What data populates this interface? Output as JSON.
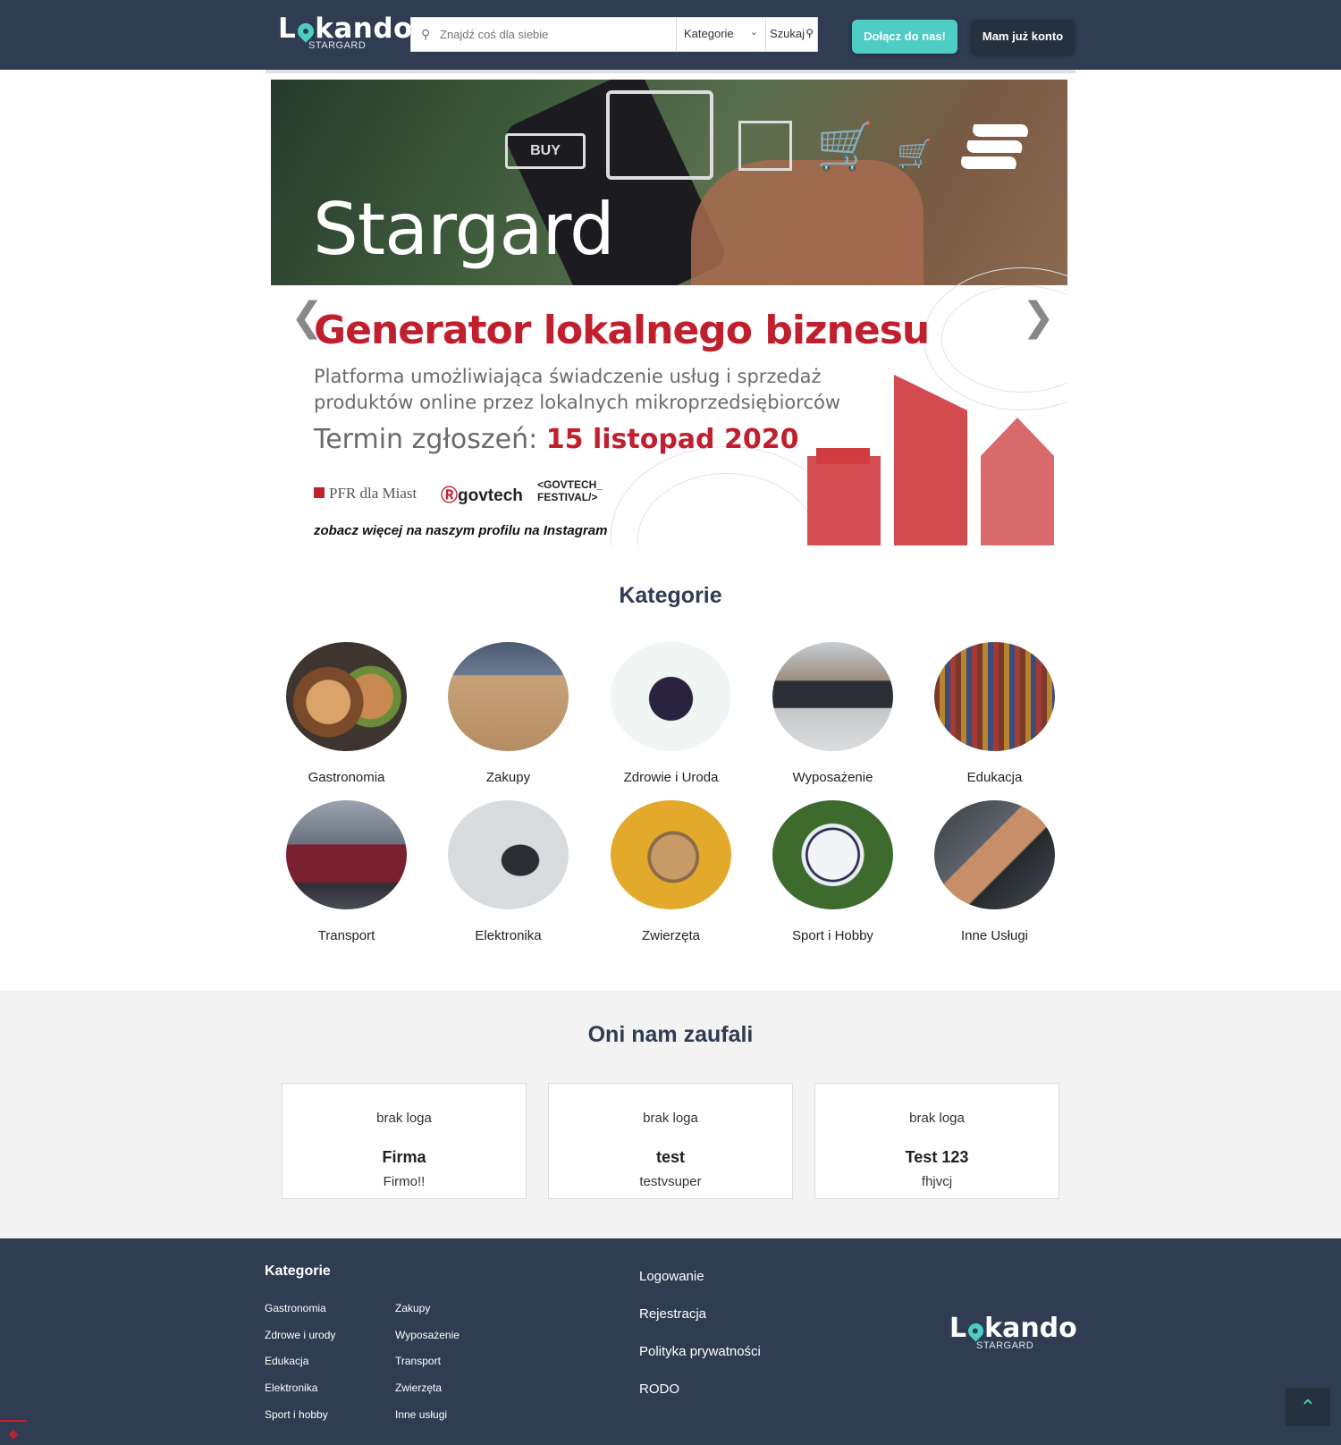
{
  "header": {
    "logo": {
      "text_start": "L",
      "text_end": "kando",
      "sub": "STARGARD"
    },
    "search": {
      "placeholder": "Znajdź coś dla siebie",
      "category_label": "Kategorie",
      "button_label": "Szukaj"
    },
    "join_label": "Dołącz do nas!",
    "login_label": "Mam już konto"
  },
  "banner": {
    "city": "Stargard",
    "buy_label": "BUY",
    "headline": "Generator lokalnego biznesu",
    "desc_line1": "Platforma umożliwiająca świadczenie usług i sprzedaż",
    "desc_line2": "produktów online przez lokalnych mikroprzedsiębiorców",
    "deadline_label": "Termin zgłoszeń: ",
    "deadline_date": "15 listopad 2020",
    "partner1": "PFR dla Miast",
    "partner2": "govtech",
    "partner3_line1": "<GOVTECH_",
    "partner3_line2": "FESTIVAL/>",
    "instagram_note": "zobacz więcej na naszym profilu na Instagram",
    "prev_icon": "chevron-left-icon",
    "next_icon": "chevron-right-icon"
  },
  "categories": {
    "title": "Kategorie",
    "items": [
      {
        "label": "Gastronomia"
      },
      {
        "label": "Zakupy"
      },
      {
        "label": "Zdrowie i Uroda"
      },
      {
        "label": "Wyposażenie"
      },
      {
        "label": "Edukacja"
      },
      {
        "label": "Transport"
      },
      {
        "label": "Elektronika"
      },
      {
        "label": "Zwierzęta"
      },
      {
        "label": "Sport i Hobby"
      },
      {
        "label": "Inne Usługi"
      }
    ]
  },
  "trusted": {
    "title": "Oni nam zaufali",
    "cards": [
      {
        "logo": "brak loga",
        "name": "Firma",
        "desc": "Firmo!!"
      },
      {
        "logo": "brak loga",
        "name": "test",
        "desc": "testvsuper"
      },
      {
        "logo": "brak loga",
        "name": "Test 123",
        "desc": "fhjvcj"
      }
    ]
  },
  "footer": {
    "categories_title": "Kategorie",
    "col1": [
      "Gastronomia",
      "Zdrowe i urody",
      "Edukacja",
      "Elektronika",
      "Sport i hobby"
    ],
    "col2": [
      "Zakupy",
      "Wyposażenie",
      "Transport",
      "Zwierzęta",
      "Inne usługi"
    ],
    "links": [
      "Logowanie",
      "Rejestracja",
      "Polityka prywatności",
      "RODO"
    ],
    "logo": {
      "text_start": "L",
      "text_end": "kando",
      "sub": "STARGARD"
    }
  },
  "colors": {
    "header_bg": "#2f3c52",
    "accent": "#4ecdc4",
    "brand_red": "#c0202e"
  }
}
